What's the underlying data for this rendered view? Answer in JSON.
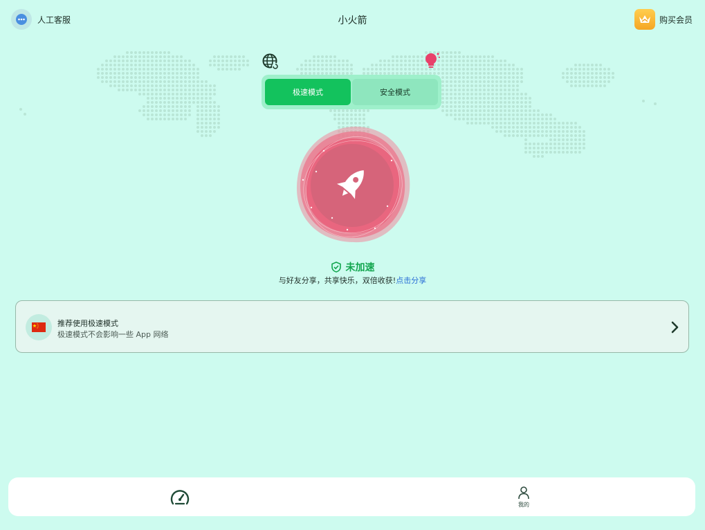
{
  "header": {
    "support_label": "人工客服",
    "support_icon": "headset-chat-icon",
    "title": "小火箭",
    "vip_label": "购买会员",
    "vip_icon": "crown-icon"
  },
  "toolbar": {
    "globe_icon": "globe-refresh-icon",
    "bulb_icon": "lightbulb-icon"
  },
  "mode": {
    "options": [
      "极速模式",
      "安全模式"
    ],
    "selected": "极速模式"
  },
  "accelerate": {
    "icon": "rocket-icon",
    "status_label": "未加速",
    "status_icon": "shield-check-icon"
  },
  "share": {
    "text": "与好友分享，共享快乐，双倍收获!",
    "link": "点击分享"
  },
  "recommend": {
    "flag_icon": "china-flag-icon",
    "title": "推荐使用极速模式",
    "subtitle": "极速模式不会影响一些 App 网络"
  },
  "bottom_nav": {
    "items": [
      {
        "icon": "speedometer-icon",
        "label": ""
      },
      {
        "icon": "person-icon",
        "label": "我的"
      }
    ]
  },
  "colors": {
    "background": "#cdfbef",
    "accent_green": "#13c25d",
    "rocket_pink": "#e9607a",
    "link_blue": "#2a6fd6"
  }
}
